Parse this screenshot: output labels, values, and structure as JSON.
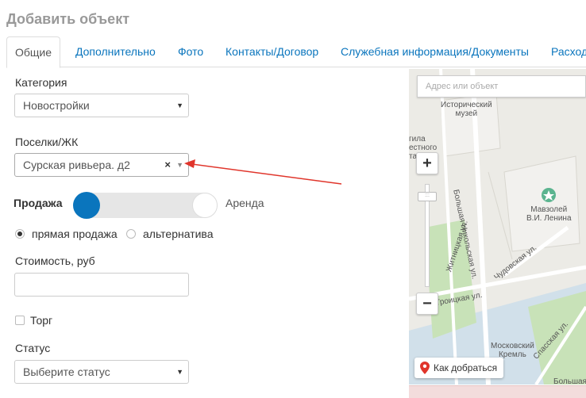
{
  "page": {
    "title": "Добавить объект"
  },
  "tabs": [
    {
      "label": "Общие",
      "active": true
    },
    {
      "label": "Дополнительно"
    },
    {
      "label": "Фото"
    },
    {
      "label": "Контакты/Договор"
    },
    {
      "label": "Служебная информация/Документы"
    },
    {
      "label": "Расход"
    }
  ],
  "form": {
    "category": {
      "label": "Категория",
      "value": "Новостройки"
    },
    "complex": {
      "label": "Поселки/ЖК",
      "value": "Сурская ривьера. д2",
      "clear": "×"
    },
    "deal_toggle": {
      "left_label": "Продажа",
      "right_label": "Аренда",
      "selected": "Продажа"
    },
    "sale_type": [
      {
        "label": "прямая продажа",
        "checked": true
      },
      {
        "label": "альтернатива",
        "checked": false
      }
    ],
    "price": {
      "label": "Стоимость, руб",
      "value": ""
    },
    "bargain": {
      "label": "Торг",
      "checked": false
    },
    "status": {
      "label": "Статус",
      "value": "Выберите статус"
    }
  },
  "map": {
    "search_placeholder": "Адрес или объект",
    "zoom_in": "+",
    "zoom_out": "−",
    "route_button": "Как добраться",
    "labels": [
      {
        "text": "Исторический\nмузей"
      },
      {
        "text": "гила\nестного\nта"
      },
      {
        "text": "Мавзолей\nВ.И. Ленина"
      },
      {
        "text": "Житницкая ул."
      },
      {
        "text": "Большая Никольская ул."
      },
      {
        "text": "Чудовская ул."
      },
      {
        "text": "Троицкая ул."
      },
      {
        "text": "Московский\nКремль"
      },
      {
        "text": "Спасская ул."
      },
      {
        "text": "Большая"
      }
    ]
  },
  "colors": {
    "accent": "#0a75bd",
    "arrow": "#e0352b",
    "map_bg": "#ecebe6",
    "park": "#c8e2b8",
    "river": "#b5d5ee"
  }
}
